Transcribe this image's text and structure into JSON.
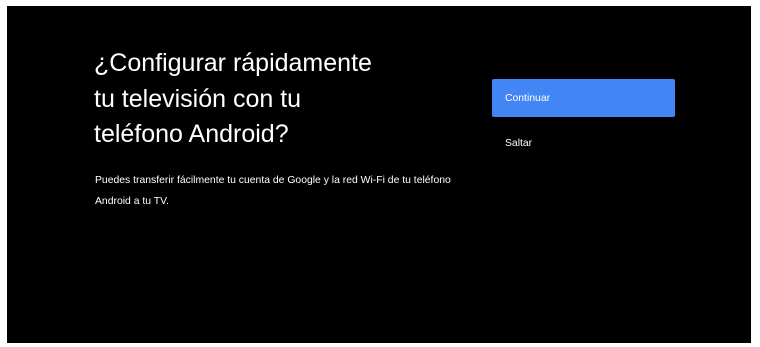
{
  "setup": {
    "title": "¿Configurar rápidamente\ntu televisión con tu\nteléfono Android?",
    "description": "Puedes transferir fácilmente tu cuenta de Google y la red Wi-Fi de tu teléfono Android a tu TV."
  },
  "actions": {
    "continue_label": "Continuar",
    "skip_label": "Saltar"
  },
  "colors": {
    "background": "#000000",
    "accent": "#4285f4",
    "text": "#ffffff"
  }
}
